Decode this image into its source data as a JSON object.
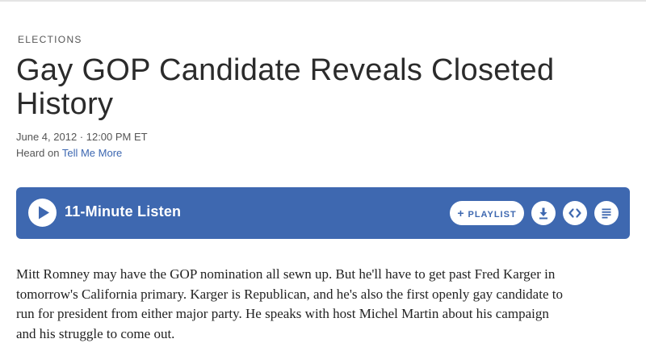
{
  "story": {
    "section": "ELECTIONS",
    "headline": "Gay GOP Candidate Reveals Closeted History",
    "dateline": "June 4, 2012 · 12:00 PM ET",
    "heard_on_prefix": "Heard on ",
    "program": "Tell Me More"
  },
  "player": {
    "listen_label": "11-Minute Listen",
    "playlist_label": "PLAYLIST",
    "playlist_icon": "plus-icon",
    "play_icon": "play-icon",
    "download_icon": "download-icon",
    "embed_icon": "embed-code-icon",
    "transcript_icon": "transcript-lines-icon",
    "accent_color": "#3e68b0"
  },
  "teaser": {
    "text": "Mitt Romney may have the GOP nomination all sewn up. But he'll have to get past Fred Karger in tomorrow's California primary. Karger is Republican, and he's also the first openly gay candidate to run for president from either major party. He speaks with host Michel Martin about his campaign and his struggle to come out."
  }
}
